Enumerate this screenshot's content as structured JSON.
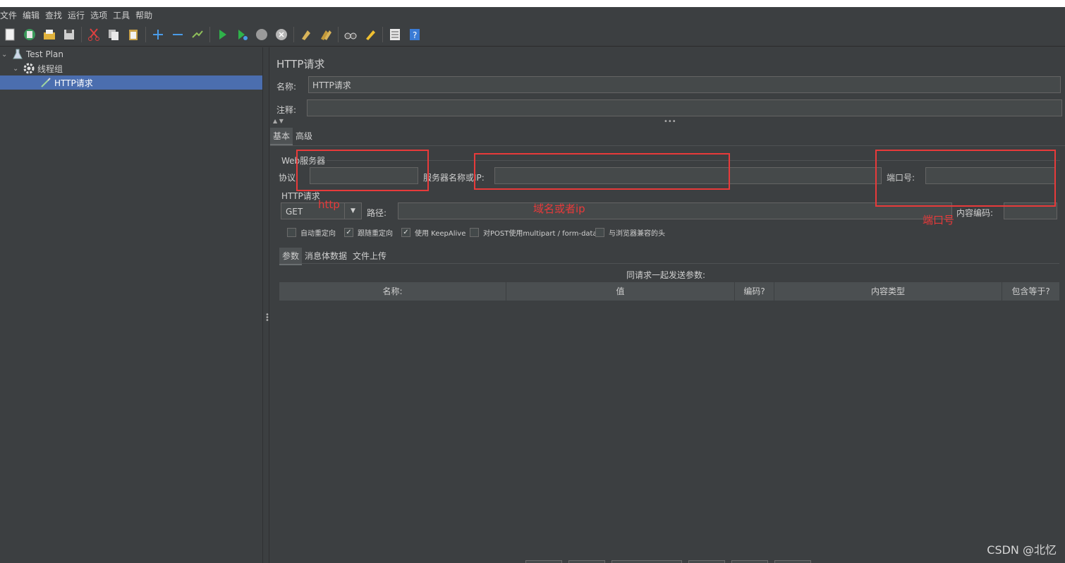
{
  "menu": [
    "文件",
    "编辑",
    "查找",
    "运行",
    "选项",
    "工具",
    "帮助"
  ],
  "toolbar_icons": [
    "new-icon",
    "templates-icon",
    "open-icon",
    "save-icon",
    "cut-icon",
    "copy-icon",
    "paste-icon",
    "expand-icon",
    "collapse-icon",
    "toggle-icon",
    "start-icon",
    "start-no-pause-icon",
    "stop-icon",
    "shutdown-icon",
    "clear-icon",
    "clear-all-icon",
    "search-icon",
    "reset-search-icon",
    "function-helper-icon",
    "help-icon"
  ],
  "tree": {
    "root": "Test Plan",
    "thread_group": "线程组",
    "sampler": "HTTP请求"
  },
  "panel": {
    "title": "HTTP请求",
    "name_label": "名称:",
    "name_value": "HTTP请求",
    "comment_label": "注释:",
    "comment_value": "",
    "tabs": [
      "基本",
      "高级"
    ],
    "web_server_label": "Web服务器",
    "protocol_label": "协议:",
    "protocol_value": "",
    "server_label": "服务器名称或IP:",
    "server_value": "",
    "port_label": "端口号:",
    "port_value": "",
    "http_request_label": "HTTP请求",
    "method": "GET",
    "path_label": "路径:",
    "path_value": "",
    "encoding_label": "内容编码:",
    "encoding_value": "",
    "checkboxes": [
      {
        "label": "自动重定向",
        "checked": false
      },
      {
        "label": "跟随重定向",
        "checked": true
      },
      {
        "label": "使用 KeepAlive",
        "checked": true
      },
      {
        "label": "对POST使用multipart / form-data",
        "checked": false
      },
      {
        "label": "与浏览器兼容的头",
        "checked": false
      }
    ],
    "sub_tabs": [
      "参数",
      "消息体数据",
      "文件上传"
    ],
    "params_caption": "同请求一起发送参数:",
    "columns": [
      "名称:",
      "值",
      "编码?",
      "内容类型",
      "包含等于?"
    ]
  },
  "annotations": {
    "protocol_note": "http",
    "server_note": "域名或者ip",
    "port_note": "端口号",
    "color": "#e83a3a"
  },
  "watermark": "CSDN @北忆"
}
